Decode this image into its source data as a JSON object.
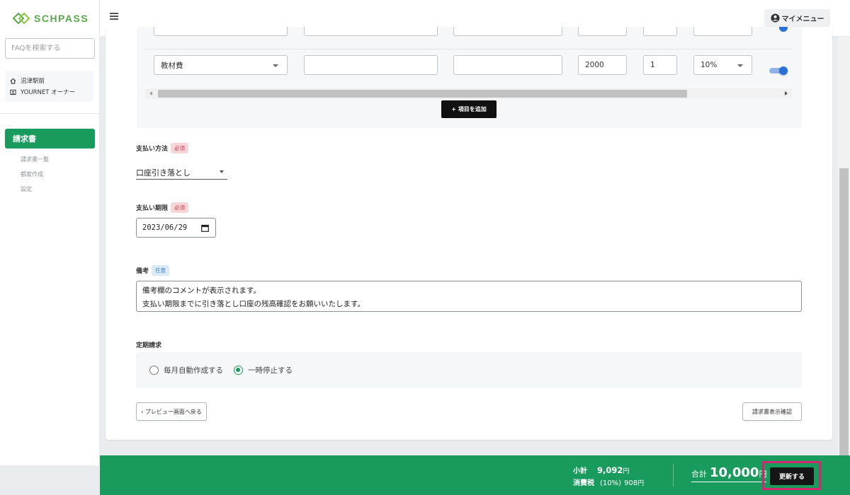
{
  "app": {
    "logo_text": "SCHPASS"
  },
  "sidebar": {
    "faq_placeholder": "FAQを検索する",
    "store_name": "沼津駅前",
    "owner_name": "YOURNET オーナー",
    "section_title": "請求書",
    "sub_items": [
      "請求書一覧",
      "都度作成",
      "設定"
    ]
  },
  "header": {
    "my_menu_label": "マイメニュー"
  },
  "items": {
    "row": {
      "category": "教材費",
      "name": "",
      "description": "",
      "price": "2000",
      "quantity": "1",
      "tax_rate": "10%",
      "enabled": true
    },
    "add_item_label": "+ 項目を追加"
  },
  "payment_method": {
    "label": "支払い方法",
    "badge": "必須",
    "value": "口座引き落とし"
  },
  "payment_due": {
    "label": "支払い期限",
    "badge": "必須",
    "value": "2023/06/29"
  },
  "memo": {
    "label": "備考",
    "badge": "任意",
    "line1": "備考欄のコメントが表示されます。",
    "line2": "支払い期限までに引き落とし口座の残高確認をお願いいたします。"
  },
  "recurring": {
    "label": "定期請求",
    "options": [
      "毎月自動作成する",
      "一時停止する"
    ],
    "selected_index": 1
  },
  "buttons": {
    "back_label": "‹ プレビュー画面へ戻る",
    "confirm_label": "請求書表示確認"
  },
  "footer": {
    "subtotal_label": "小計",
    "subtotal_value": "9,092",
    "tax_label": "消費税",
    "tax_rate": "(10%)",
    "tax_value": "908",
    "yen": "円",
    "total_label": "合計",
    "total_value": "10,000",
    "update_label": "更新する"
  },
  "colors": {
    "brand_green": "#1a9b5e",
    "highlight": "#d6246e",
    "toggle_blue": "#2a6fd6"
  }
}
